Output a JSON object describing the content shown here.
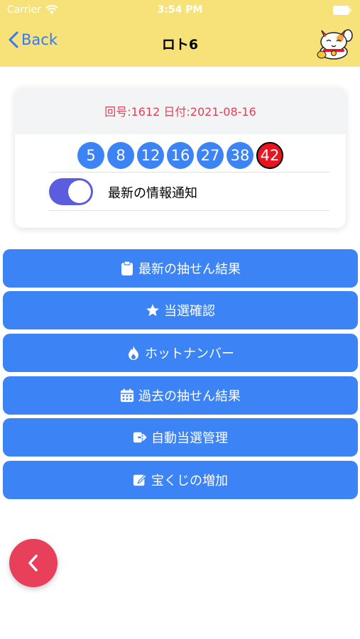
{
  "status_bar": {
    "carrier": "Carrier",
    "time": "3:54 PM"
  },
  "nav": {
    "back_label": "Back",
    "title": "ロト6",
    "mascot": "maneki-neko-icon"
  },
  "result": {
    "header": "回号:1612 日付:2021-08-16",
    "numbers": [
      "5",
      "8",
      "12",
      "16",
      "27",
      "38"
    ],
    "bonus": "42",
    "notify_label": "最新の情報通知",
    "notify_on": true
  },
  "menu": [
    {
      "label": "最新の抽せん結果",
      "icon": "clipboard-icon"
    },
    {
      "label": "当選確認",
      "icon": "star-icon"
    },
    {
      "label": "ホットナンバー",
      "icon": "fire-icon"
    },
    {
      "label": "過去の抽せん結果",
      "icon": "calendar-icon"
    },
    {
      "label": "自動当選管理",
      "icon": "sign-in-icon"
    },
    {
      "label": "宝くじの増加",
      "icon": "edit-icon"
    }
  ],
  "fab": {
    "icon": "chevron-left-icon"
  },
  "colors": {
    "header_bg": "#f7e27a",
    "accent_blue": "#3c83f6",
    "bonus_red": "#e8141f",
    "fab_red": "#e8405b",
    "toggle_on": "#5b5ce0",
    "date_text": "#e0415a"
  }
}
